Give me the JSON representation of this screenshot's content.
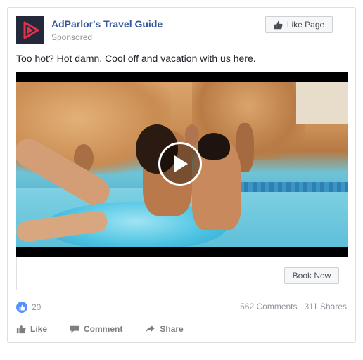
{
  "post": {
    "page_name": "AdParlor's Travel Guide",
    "sponsored_label": "Sponsored",
    "like_page_label": "Like Page",
    "text": "Too hot? Hot damn. Cool off and vacation with us here.",
    "avatar_color": "#23283a",
    "avatar_accent": "#e5304a"
  },
  "media": {
    "play_icon": "play-icon"
  },
  "cta": {
    "label": "Book Now"
  },
  "stats": {
    "likes": "20",
    "comments": "562 Comments",
    "shares": "311 Shares"
  },
  "actions": {
    "like": "Like",
    "comment": "Comment",
    "share": "Share"
  },
  "colors": {
    "link_blue": "#365899",
    "reaction_blue": "#5890ff",
    "muted_text": "#90949c"
  }
}
